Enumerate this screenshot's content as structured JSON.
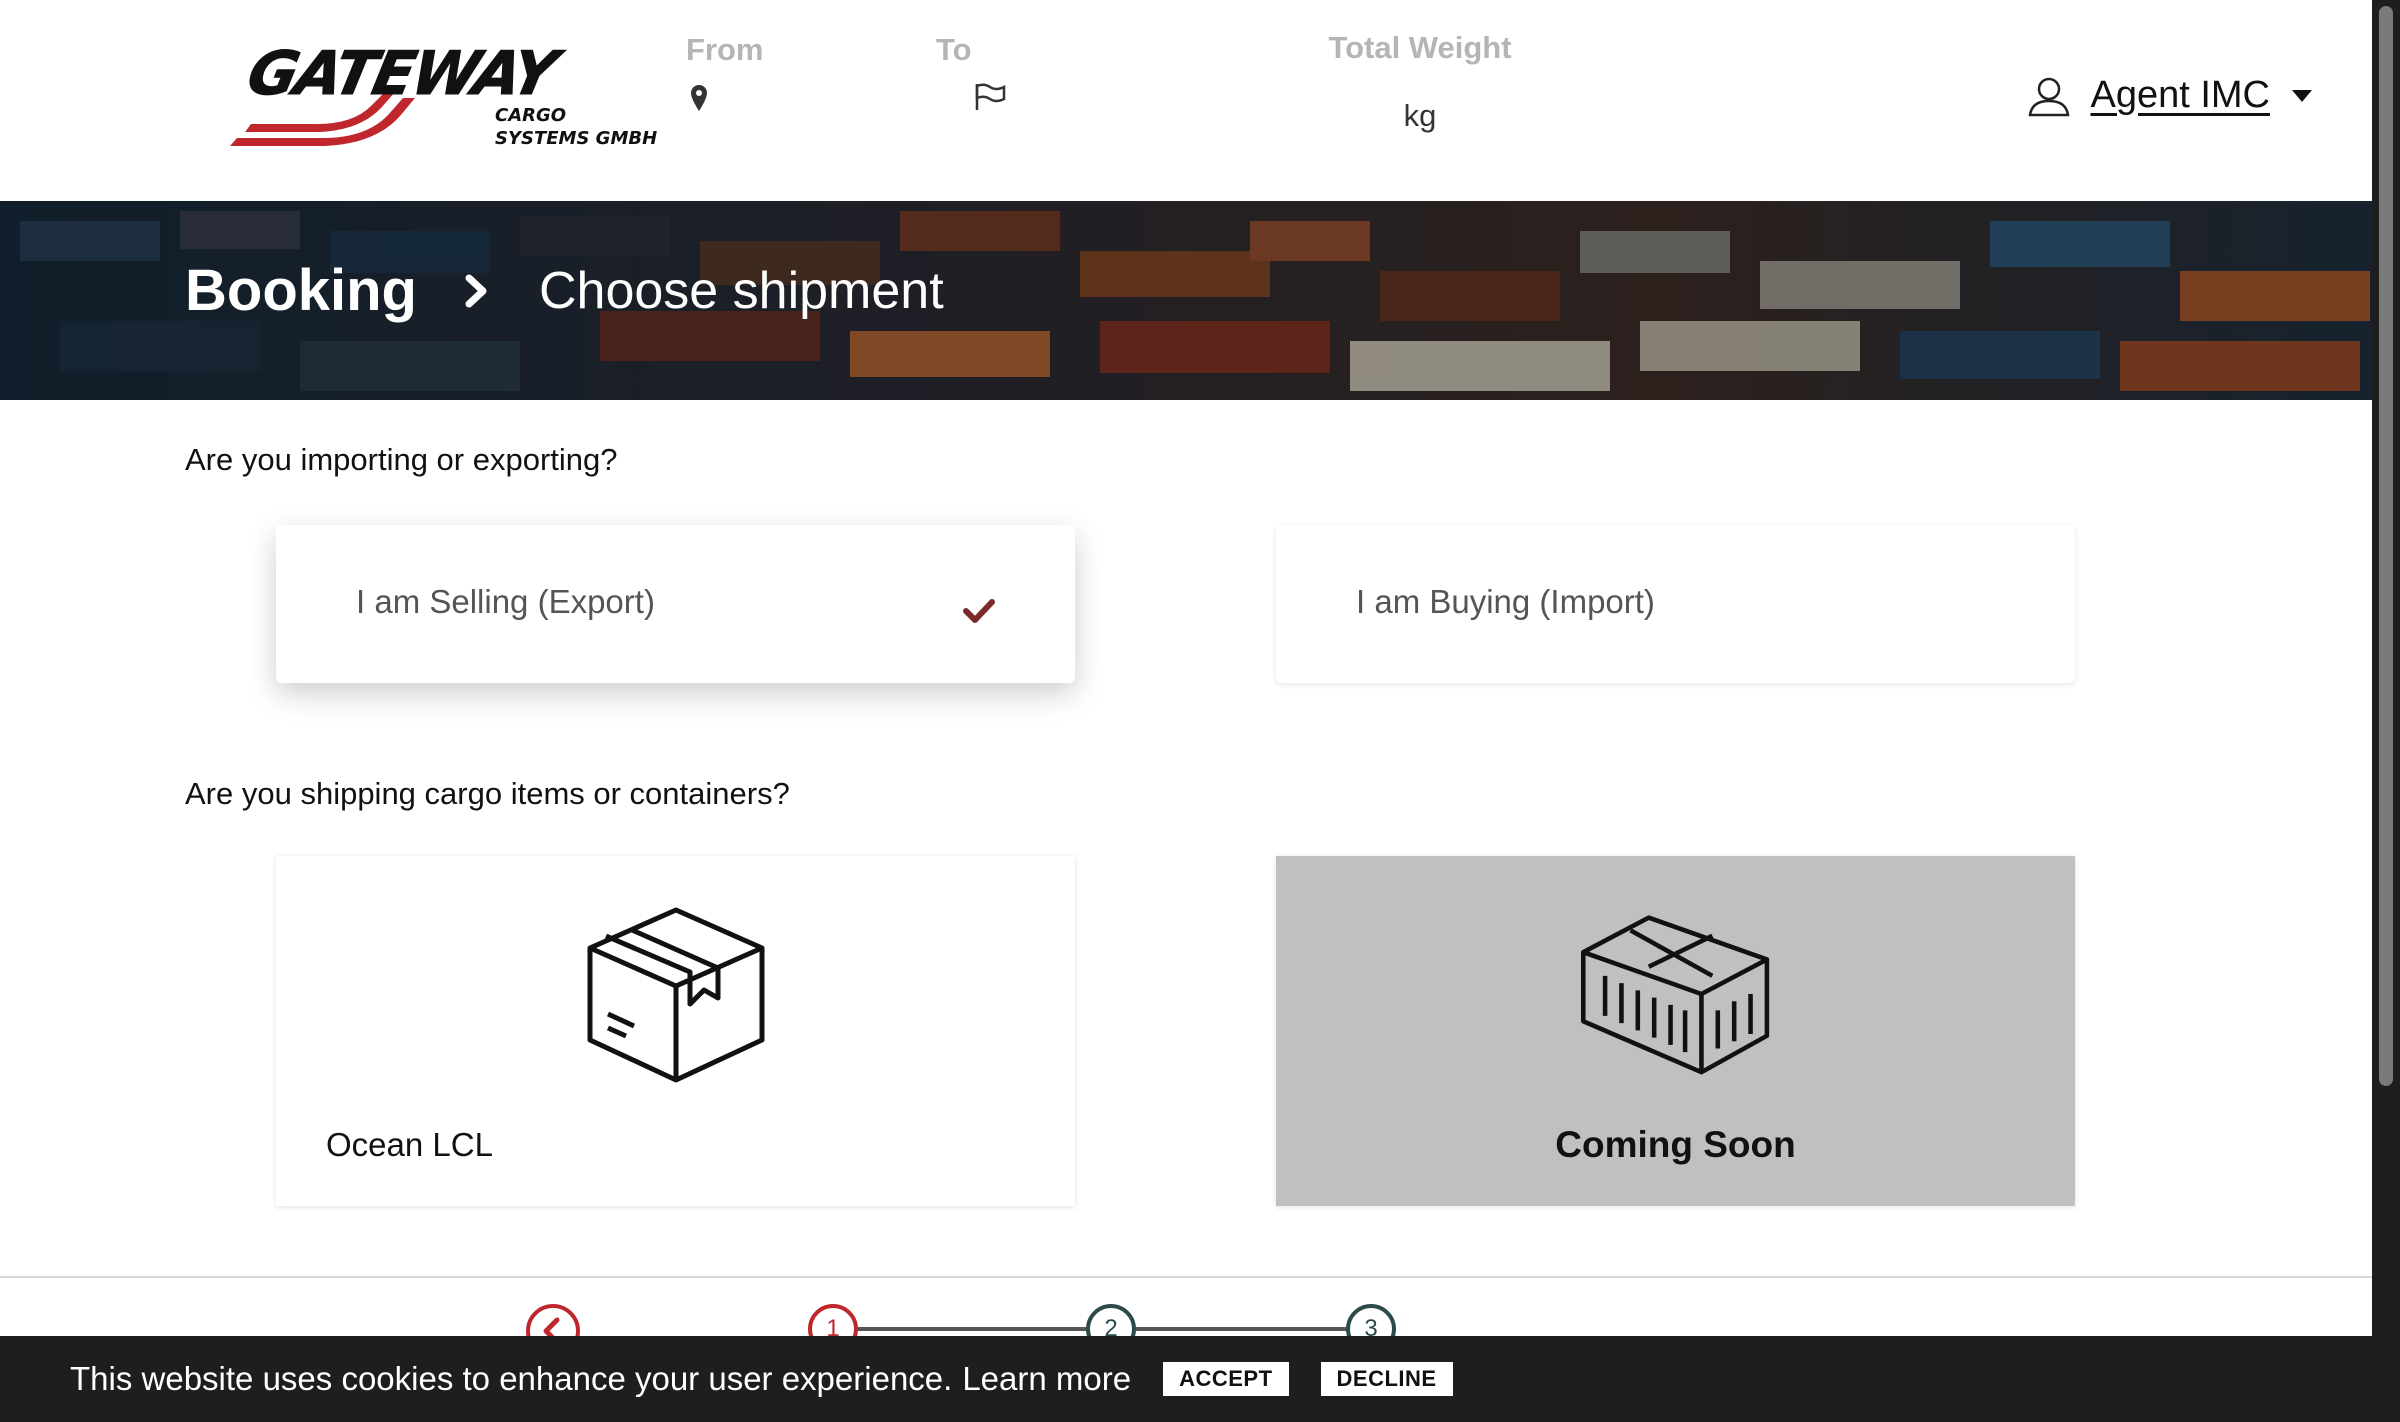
{
  "header": {
    "logo_text": "GATEWAY",
    "logo_subtext": "CARGO SYSTEMS GMBH",
    "route": {
      "from_label": "From",
      "to_label": "To"
    },
    "weight": {
      "label": "Total Weight",
      "unit": "kg"
    },
    "user": {
      "name": "Agent IMC",
      "icon": "user-icon"
    }
  },
  "banner": {
    "crumb": "Booking",
    "current": "Choose shipment"
  },
  "trade": {
    "question": "Are you importing or exporting?",
    "options": [
      {
        "label": "I am Selling (Export)",
        "selected": true
      },
      {
        "label": "I am Buying (Import)",
        "selected": false
      }
    ]
  },
  "shipping": {
    "question": "Are you shipping cargo items or containers?",
    "options": [
      {
        "label": "Ocean LCL",
        "icon": "box-icon",
        "disabled": false
      },
      {
        "label": "Coming Soon",
        "icon": "container-icon",
        "disabled": true
      }
    ]
  },
  "stepper": {
    "steps": [
      "1",
      "2",
      "3"
    ],
    "active_step": 1
  },
  "cookie": {
    "message": "This website uses cookies to enhance your user experience.",
    "learn_more": "Learn more",
    "accept": "ACCEPT",
    "decline": "DECLINE"
  },
  "colors": {
    "brand_red": "#c0272d",
    "check": "#7a2a2a",
    "disabled_card": "#c0c0c0",
    "cookie_bar": "#1e1e1e"
  }
}
